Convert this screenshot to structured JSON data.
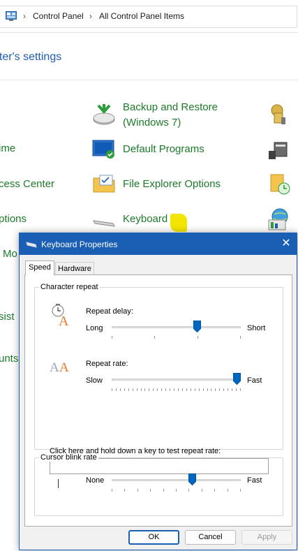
{
  "address_bar": {
    "crumbs": [
      "Control Panel",
      "All Control Panel Items"
    ]
  },
  "heading": "uter's settings",
  "control_panel_items": {
    "col_left": [
      "ime",
      "cess Center",
      "ptions",
      "Mo",
      "sist",
      "unts"
    ],
    "col_middle": [
      {
        "label_line1": "Backup and Restore",
        "label_line2": "(Windows 7)"
      },
      {
        "label_line1": "Default Programs"
      },
      {
        "label_line1": "File Explorer Options"
      },
      {
        "label_line1": "Keyboard"
      }
    ]
  },
  "dialog": {
    "title": "Keyboard Properties",
    "close_glyph": "✕",
    "tabs": [
      "Speed",
      "Hardware"
    ],
    "character_repeat": {
      "group_label": "Character repeat",
      "repeat_delay": {
        "label": "Repeat delay:",
        "min_label": "Long",
        "max_label": "Short",
        "value_fraction": 0.67,
        "tick_count": 4
      },
      "repeat_rate": {
        "label": "Repeat rate:",
        "min_label": "Slow",
        "max_label": "Fast",
        "value_fraction": 1.0,
        "tick_count": 32
      },
      "test_prompt": "Click here and hold down a key to test repeat rate:",
      "test_value": ""
    },
    "cursor_blink": {
      "group_label": "Cursor blink rate",
      "min_label": "None",
      "max_label": "Fast",
      "value_fraction": 0.63,
      "tick_count": 11
    },
    "buttons": {
      "ok": "OK",
      "cancel": "Cancel",
      "apply": "Apply"
    }
  },
  "colors": {
    "accent": "#1a5fb4",
    "link_green": "#1c7a2a",
    "heading_blue": "#1e5cb3",
    "thumb": "#0067c0"
  }
}
